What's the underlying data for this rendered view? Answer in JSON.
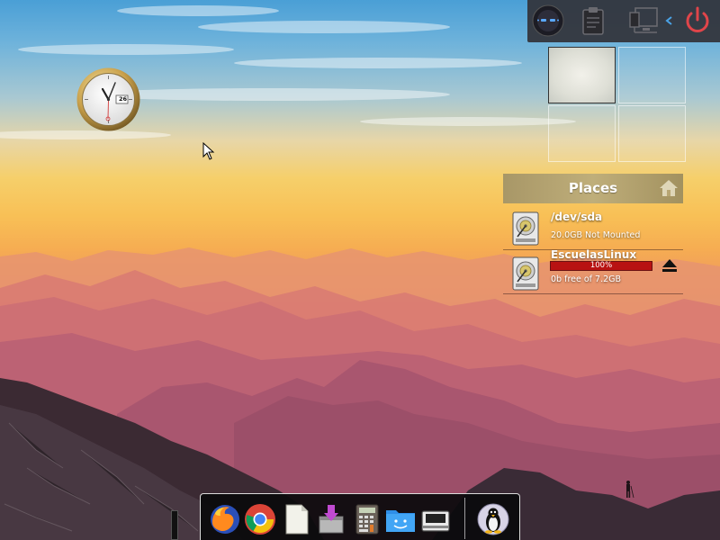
{
  "top_panel": {
    "items": [
      {
        "name": "user-avatar-icon"
      },
      {
        "name": "clipboard-icon"
      },
      {
        "name": "network-wired-icon"
      },
      {
        "name": "chevron-left-icon"
      },
      {
        "name": "power-icon"
      }
    ],
    "colors": {
      "power": "#e0454a",
      "chevron": "#4aa3e6"
    }
  },
  "clock": {
    "date_label": "26"
  },
  "pager": {
    "workspaces": [
      {
        "name": "workspace-1",
        "active": true
      },
      {
        "name": "workspace-2",
        "active": false
      },
      {
        "name": "workspace-3",
        "active": false
      },
      {
        "name": "workspace-4",
        "active": false
      }
    ]
  },
  "places": {
    "title": "Places",
    "items": [
      {
        "title": "/dev/sda",
        "subtitle": "20.0GB Not Mounted"
      },
      {
        "title": "EscuelasLinux",
        "usage_percent": 100,
        "usage_label": "100%",
        "subtitle": "0b free of 7.2GB"
      }
    ]
  },
  "dock": {
    "apps": [
      {
        "name": "firefox-icon"
      },
      {
        "name": "chrome-icon"
      },
      {
        "name": "text-document-icon"
      },
      {
        "name": "package-installer-icon"
      },
      {
        "name": "calculator-icon"
      },
      {
        "name": "file-manager-icon"
      },
      {
        "name": "scanner-icon"
      },
      {
        "name": "tux-icon"
      }
    ]
  }
}
